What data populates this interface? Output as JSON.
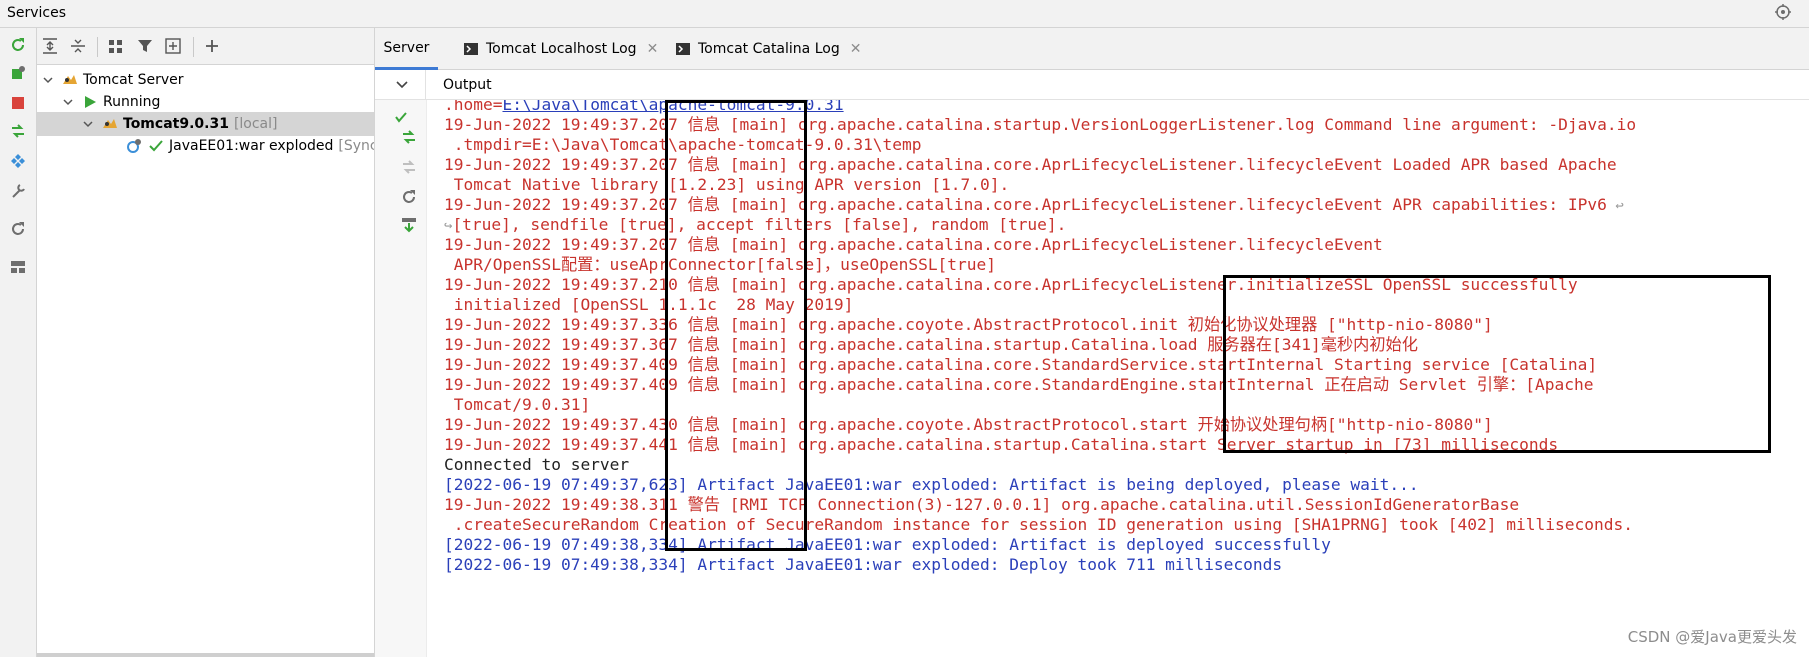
{
  "window": {
    "title": "Services"
  },
  "toolstrip": [
    "rerun-icon",
    "deploy-icon",
    "stop-icon",
    "update-icon",
    "artifact-icon",
    "settings-wrench-icon",
    "refresh-icon",
    "layout-icon"
  ],
  "tree_toolbar": [
    "expand-all-icon",
    "collapse-all-icon",
    "group-icon",
    "filter-icon",
    "new-group-icon",
    "add-icon"
  ],
  "tree": {
    "server": "Tomcat Server",
    "running": "Running",
    "instance": {
      "name": "Tomcat9.0.31",
      "tag": "[local]"
    },
    "artifact": {
      "name": "JavaEE01:war exploded",
      "status": "[Sync"
    }
  },
  "tabs": [
    {
      "label": "Server",
      "active": true
    },
    {
      "label": "Tomcat Localhost Log",
      "close": "✕"
    },
    {
      "label": "Tomcat Catalina Log",
      "close": "✕"
    }
  ],
  "output": {
    "label": "Output",
    "top_cut": {
      "prefix": ".home=",
      "link": "E:\\Java\\Tomcat\\apache-tomcat-9.0.31"
    },
    "lines": [
      {
        "t": "19-Jun-2022 19:49:37.207 信息 [main] org.apache.catalina.startup.VersionLoggerListener.log Command line argument: -Djava.io",
        "c": "red"
      },
      {
        "t": " .tmpdir=E:\\Java\\Tomcat\\apache-tomcat-9.0.31\\temp",
        "c": "red"
      },
      {
        "t": "19-Jun-2022 19:49:37.207 信息 [main] org.apache.catalina.core.AprLifecycleListener.lifecycleEvent Loaded APR based Apache",
        "c": "red"
      },
      {
        "t": " Tomcat Native library [1.2.23] using APR version [1.7.0].",
        "c": "red"
      },
      {
        "t": "19-Jun-2022 19:49:37.207 信息 [main] org.apache.catalina.core.AprLifecycleListener.lifecycleEvent APR capabilities: IPv6",
        "c": "red",
        "wrap_end": "↩"
      },
      {
        "t": "[true], sendfile [true], accept filters [false], random [true].",
        "c": "red",
        "wrap_start": "↪"
      },
      {
        "t": "19-Jun-2022 19:49:37.207 信息 [main] org.apache.catalina.core.AprLifecycleListener.lifecycleEvent",
        "c": "red"
      },
      {
        "t": " APR/OpenSSL配置：useAprConnector[false]，useOpenSSL[true]",
        "c": "red"
      },
      {
        "t": "19-Jun-2022 19:49:37.210 信息 [main] org.apache.catalina.core.AprLifecycleListener.initializeSSL OpenSSL successfully",
        "c": "red"
      },
      {
        "t": " initialized [OpenSSL 1.1.1c  28 May 2019]",
        "c": "red"
      },
      {
        "t": "19-Jun-2022 19:49:37.336 信息 [main] org.apache.coyote.AbstractProtocol.init 初始化协议处理器 [\"http-nio-8080\"]",
        "c": "red"
      },
      {
        "t": "19-Jun-2022 19:49:37.367 信息 [main] org.apache.catalina.startup.Catalina.load 服务器在[341]毫秒内初始化",
        "c": "red"
      },
      {
        "t": "19-Jun-2022 19:49:37.409 信息 [main] org.apache.catalina.core.StandardService.startInternal Starting service [Catalina]",
        "c": "red"
      },
      {
        "t": "19-Jun-2022 19:49:37.409 信息 [main] org.apache.catalina.core.StandardEngine.startInternal 正在启动 Servlet 引擎：[Apache",
        "c": "red"
      },
      {
        "t": " Tomcat/9.0.31]",
        "c": "red"
      },
      {
        "t": "19-Jun-2022 19:49:37.430 信息 [main] org.apache.coyote.AbstractProtocol.start 开始协议处理句柄[\"http-nio-8080\"]",
        "c": "red"
      },
      {
        "t": "19-Jun-2022 19:49:37.441 信息 [main] org.apache.catalina.startup.Catalina.start Server startup in [73] milliseconds",
        "c": "red"
      },
      {
        "t": "Connected to server",
        "c": "blk"
      },
      {
        "t": "[2022-06-19 07:49:37,623] Artifact JavaEE01:war exploded: Artifact is being deployed, please wait...",
        "c": "blue"
      },
      {
        "t": "19-Jun-2022 19:49:38.311 警告 [RMI TCP Connection(3)-127.0.0.1] org.apache.catalina.util.SessionIdGeneratorBase",
        "c": "red"
      },
      {
        "t": " .createSecureRandom Creation of SecureRandom instance for session ID generation using [SHA1PRNG] took [402] milliseconds.",
        "c": "red"
      },
      {
        "t": "[2022-06-19 07:49:38,334] Artifact JavaEE01:war exploded: Artifact is deployed successfully",
        "c": "blue"
      },
      {
        "t": "[2022-06-19 07:49:38,334] Artifact JavaEE01:war exploded: Deploy took 711 milliseconds",
        "c": "blue"
      }
    ]
  },
  "watermark": "CSDN @爱Java更爱头发",
  "colors": {
    "log_red": "#c8332d",
    "log_blue": "#2a3fb9",
    "tab_accent": "#3d7ad4",
    "run_green": "#3aa53a"
  }
}
